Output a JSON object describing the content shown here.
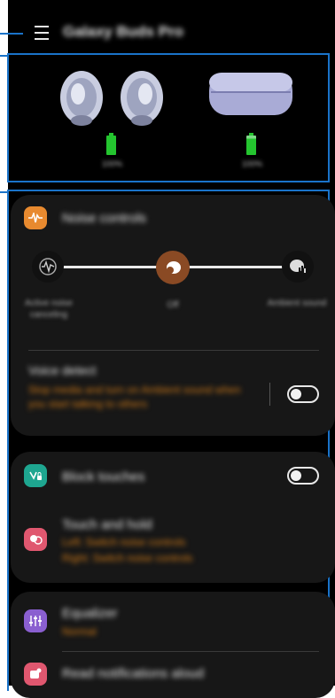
{
  "header": {
    "title": "Galaxy Buds Pro"
  },
  "devices": {
    "left_battery_label": "100%",
    "right_battery_label": "100%",
    "case_battery_label": "100%",
    "left_level": 1.0,
    "right_level": 1.0,
    "case_level": 0.85
  },
  "noise": {
    "title": "Noise controls",
    "modes": [
      {
        "label": "Active noise canceling"
      },
      {
        "label": "Off"
      },
      {
        "label": "Ambient sound"
      }
    ],
    "voice_detect": {
      "title": "Voice detect",
      "description": "Stop media and turn on Ambient sound when you start talking to others",
      "enabled": false
    }
  },
  "touch": {
    "block_title": "Block touches",
    "block_enabled": false,
    "hold_title": "Touch and hold",
    "hold_sub_1": "Left: Switch noise controls",
    "hold_sub_2": "Right: Switch noise controls"
  },
  "sound": {
    "eq_title": "Equalizer",
    "eq_value": "Normal",
    "notif_title": "Read notifications aloud"
  },
  "colors": {
    "accent_orange": "#d07a18",
    "noise_icon": "#e88a2f",
    "touch_icon": "#1ea690",
    "hold_icon": "#e0576f",
    "eq_icon": "#8a5fd0",
    "notif_icon": "#e0576f",
    "battery": "#24c52f",
    "callout": "#1a73c9"
  }
}
